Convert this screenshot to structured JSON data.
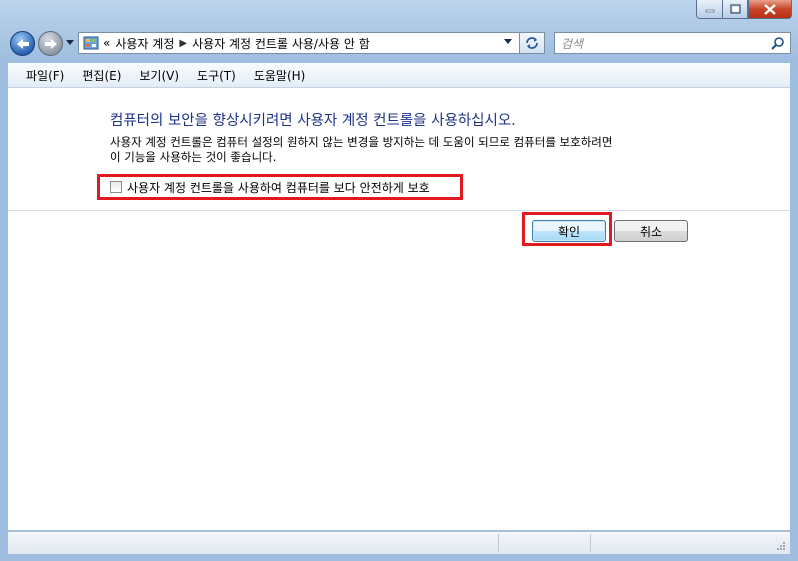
{
  "window": {
    "minimize_icon": "minimize-icon",
    "maximize_icon": "maximize-icon",
    "close_icon": "close-icon"
  },
  "nav": {
    "breadcrumb_prefix": "«",
    "crumbs": [
      "사용자 계정",
      "사용자 계정 컨트롤 사용/사용 안 함"
    ],
    "search_placeholder": "검색"
  },
  "menu": [
    "파일(F)",
    "편집(E)",
    "보기(V)",
    "도구(T)",
    "도움말(H)"
  ],
  "content": {
    "heading": "컴퓨터의 보안을 향상시키려면 사용자 계정 컨트롤을 사용하십시오.",
    "description_line1": "사용자 계정 컨트롤은 컴퓨터 설정의 원하지 않는 변경을 방지하는 데 도움이 되므로 컴퓨터를 보호하려면",
    "description_line2": "이 기능을 사용하는 것이 좋습니다.",
    "checkbox_label": "사용자 계정 컨트롤을 사용하여 컴퓨터를 보다 안전하게 보호",
    "checkbox_checked": false,
    "ok_label": "확인",
    "cancel_label": "취소"
  },
  "colors": {
    "heading": "#1e3287",
    "highlight": "#e01a20"
  }
}
